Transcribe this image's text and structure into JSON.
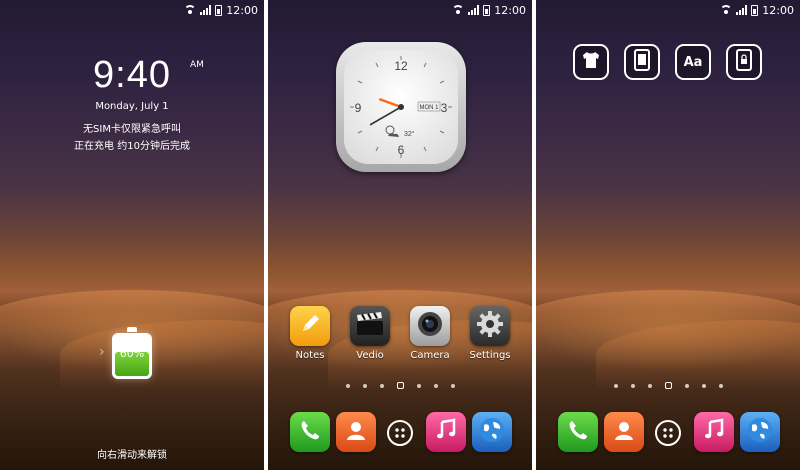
{
  "status_bar": {
    "time": "12:00"
  },
  "lock_screen": {
    "time": "9:40",
    "am_pm": "AM",
    "date": "Monday, July 1",
    "sim_notice": "无SIM卡仅限紧急呼叫",
    "charging_status": "正在充电 约10分钟后完成",
    "battery_percent": "60%",
    "battery_level": 0.6,
    "unlock_hint": "向右滑动来解锁"
  },
  "clock_widget": {
    "numerals": [
      "12",
      "3",
      "6",
      "9"
    ],
    "date_badge": "MON 1",
    "temperature": "32°",
    "weather_icon": "partly-sunny-icon",
    "hour_hand_angle_deg": 290,
    "minute_hand_angle_deg": 240
  },
  "home_apps": [
    {
      "label": "Notes",
      "icon": "notes-pencil-icon",
      "color": "#f6b21b"
    },
    {
      "label": "Vedio",
      "icon": "clapperboard-icon",
      "color": "#333333"
    },
    {
      "label": "Camera",
      "icon": "camera-lens-icon",
      "color": "#c8c8c8"
    },
    {
      "label": "Settings",
      "icon": "gear-icon",
      "color": "#444444"
    }
  ],
  "page_indicator": {
    "count": 7,
    "home_index": 3
  },
  "dock": [
    {
      "name": "phone",
      "icon": "phone-icon",
      "color": "#3fbf3a"
    },
    {
      "name": "contacts",
      "icon": "contact-person-icon",
      "color": "#f06a28"
    },
    {
      "name": "app-drawer",
      "icon": "app-drawer-icon"
    },
    {
      "name": "music",
      "icon": "music-note-icon",
      "color": "#e8347c"
    },
    {
      "name": "browser",
      "icon": "globe-icon",
      "color": "#2d7ad6"
    }
  ],
  "theme_tools": [
    {
      "name": "theme",
      "icon": "shirt-icon"
    },
    {
      "name": "screen",
      "icon": "phone-screen-icon"
    },
    {
      "name": "font",
      "icon": "font-icon",
      "text": "Aa"
    },
    {
      "name": "lockscreen",
      "icon": "phone-lock-icon"
    }
  ]
}
